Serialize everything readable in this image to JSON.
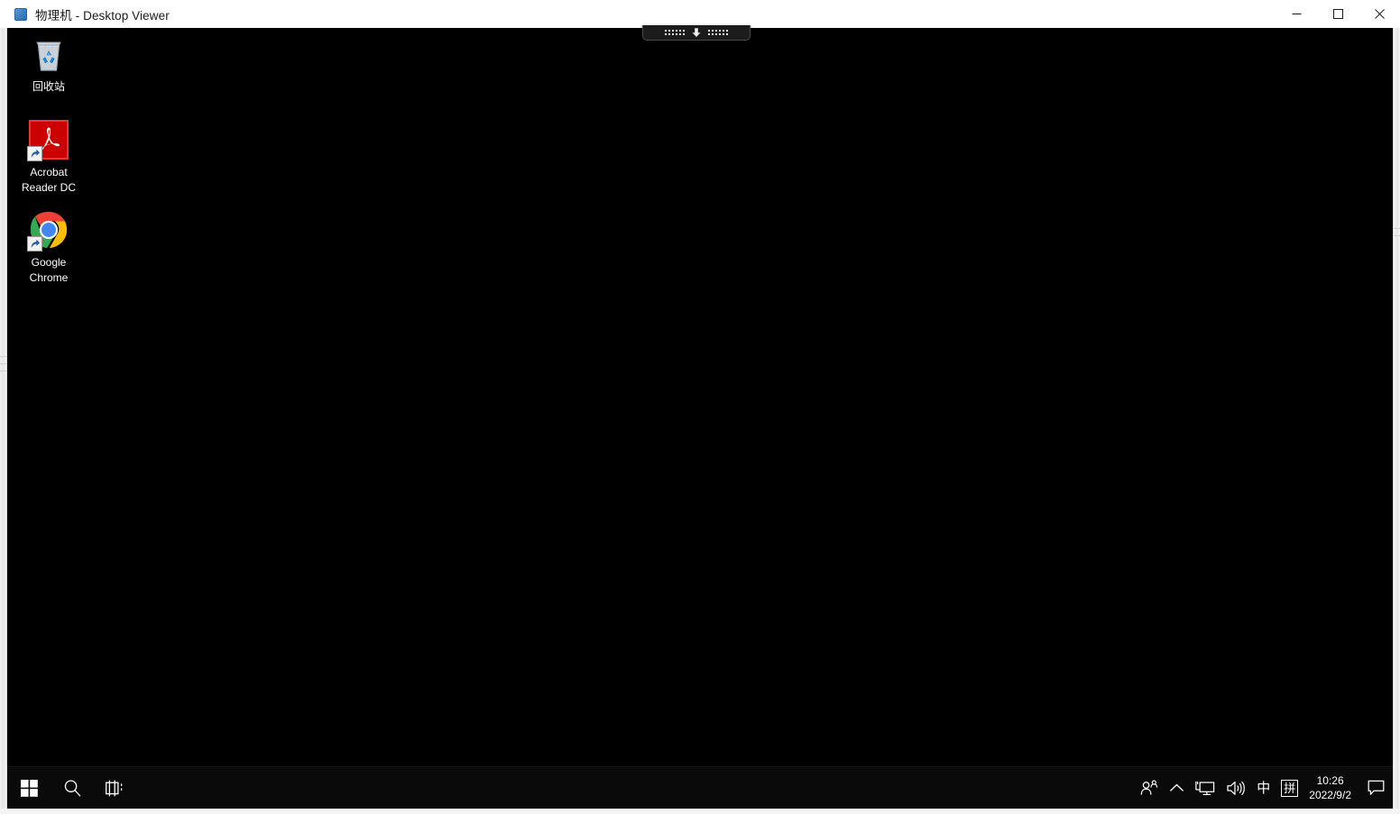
{
  "window": {
    "title": "物理机 - Desktop Viewer",
    "icon": "desktop-viewer-icon",
    "controls": {
      "minimize_label": "Minimize",
      "maximize_label": "Maximize",
      "close_label": "Close"
    }
  },
  "connection_bar": {
    "pin_icon": "pin-down-arrow-icon",
    "grip_icon": "grip-dots-icon",
    "grip_dot_count": 12
  },
  "desktop": {
    "background_color": "#000000",
    "icons": [
      {
        "id": "recycle-bin",
        "label": "回收站",
        "icon": "recycle-bin-icon",
        "shortcut": false
      },
      {
        "id": "acrobat-reader",
        "label": "Acrobat Reader DC",
        "icon": "acrobat-reader-icon",
        "shortcut": true
      },
      {
        "id": "google-chrome",
        "label": "Google Chrome",
        "icon": "chrome-icon",
        "shortcut": true
      }
    ]
  },
  "taskbar": {
    "background_color": "#0a0a0a",
    "start_label": "Start",
    "start_icon": "windows-logo-icon",
    "search_label": "Search",
    "search_icon": "search-icon",
    "task_view_label": "Task View",
    "task_view_icon": "task-view-icon",
    "tray": [
      {
        "id": "meet-now",
        "icon": "people-icon",
        "text": ""
      },
      {
        "id": "show-hidden",
        "icon": "chevron-up-icon",
        "text": ""
      },
      {
        "id": "network",
        "icon": "network-monitor-icon",
        "text": ""
      },
      {
        "id": "volume",
        "icon": "speaker-icon",
        "text": ""
      },
      {
        "id": "ime-mode",
        "icon": "ime-chinese-icon",
        "text": "中"
      },
      {
        "id": "ime-pinyin",
        "icon": "ime-pinyin-icon",
        "text": "拼"
      }
    ],
    "clock": {
      "time": "10:26",
      "date": "2022/9/2"
    },
    "action_center_icon": "action-center-icon",
    "action_center_label": "Notifications"
  }
}
